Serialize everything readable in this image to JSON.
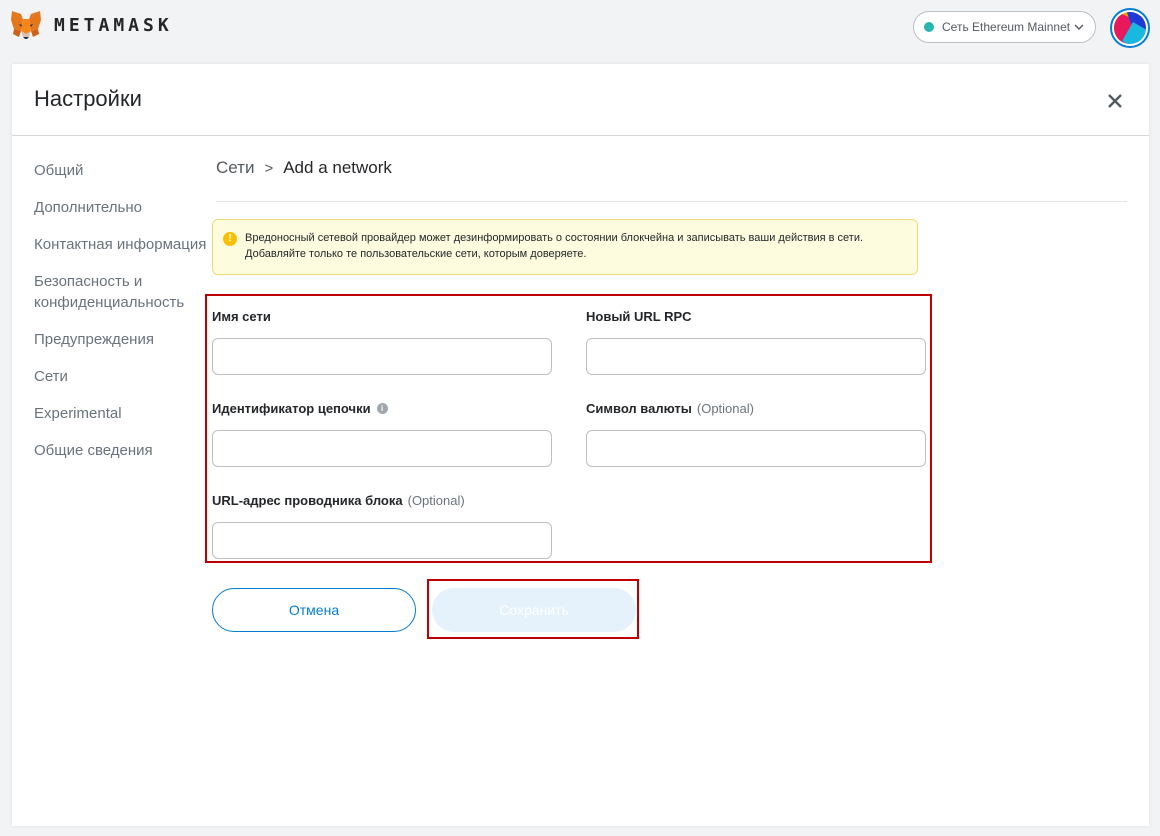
{
  "app": {
    "brand": "METAMASK",
    "network_label": "Сеть Ethereum Mainnet",
    "network_color": "#29b6af",
    "accent_color": "#037dd6"
  },
  "header": {
    "title": "Настройки",
    "close_icon": "close-icon"
  },
  "sidebar": {
    "items": [
      {
        "label": "Общий"
      },
      {
        "label": "Дополнительно"
      },
      {
        "label": "Контактная информация"
      },
      {
        "label": "Безопасность и конфиденциальность"
      },
      {
        "label": "Предупреждения"
      },
      {
        "label": "Сети"
      },
      {
        "label": "Experimental"
      },
      {
        "label": "Общие сведения"
      }
    ]
  },
  "breadcrumb": {
    "parent": "Сети",
    "separator": ">",
    "current": "Add a network"
  },
  "warning": {
    "icon": "warning-icon",
    "text": "Вредоносный сетевой провайдер может дезинформировать о состоянии блокчейна и записывать ваши действия в сети. Добавляйте только те пользовательские сети, которым доверяете."
  },
  "form": {
    "network_name": {
      "label": "Имя сети",
      "value": ""
    },
    "rpc_url": {
      "label": "Новый URL RPC",
      "value": ""
    },
    "chain_id": {
      "label": "Идентификатор цепочки",
      "value": ""
    },
    "currency_symbol": {
      "label": "Символ валюты",
      "optional": "(Optional)",
      "value": ""
    },
    "block_explorer": {
      "label": "URL-адрес проводника блока",
      "optional": "(Optional)",
      "value": ""
    }
  },
  "buttons": {
    "cancel": "Отмена",
    "save": "Сохранить"
  }
}
